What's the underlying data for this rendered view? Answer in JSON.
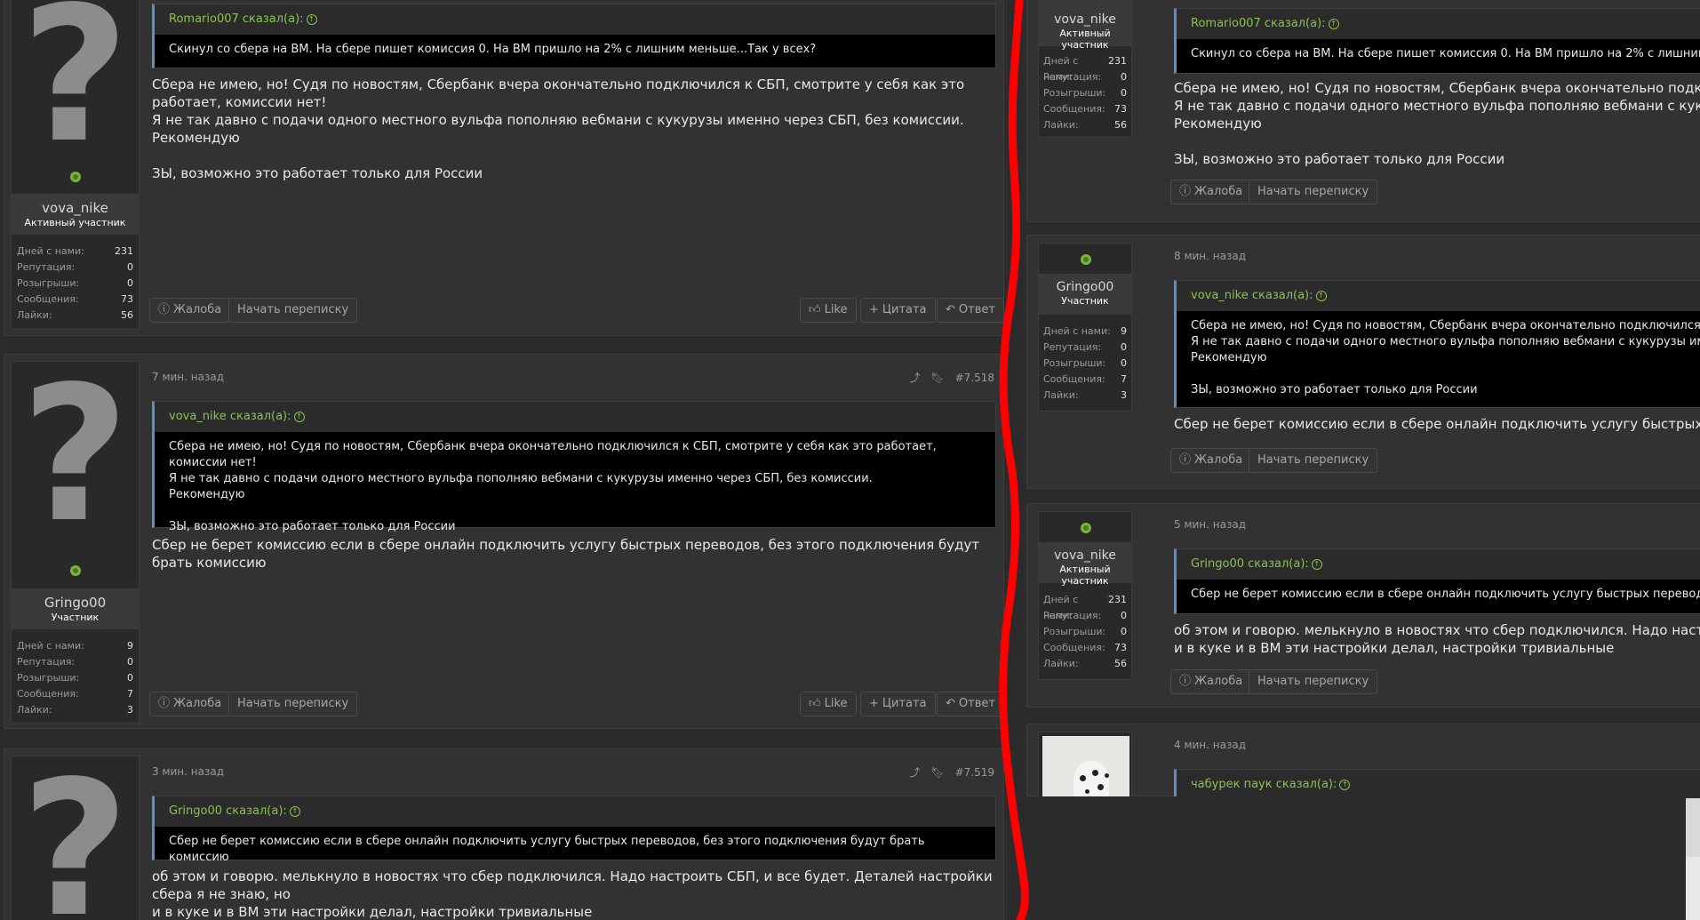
{
  "actions": {
    "report": "Жалоба",
    "start_conversation": "Начать переписку",
    "like": "Like",
    "quote": "Цитата",
    "reply": "Ответ"
  },
  "stat_labels": {
    "days": "Дней с нами:",
    "reputation": "Репутация:",
    "giveaways": "Розыгрыши:",
    "messages": "Сообщения:",
    "likes": "Лайки:"
  },
  "users": {
    "vova": {
      "name": "vova_nike",
      "title": "Активный участник",
      "days": "231",
      "reputation": "0",
      "giveaways": "0",
      "messages": "73",
      "likes": "56"
    },
    "gringo": {
      "name": "Gringo00",
      "title": "Участник",
      "days": "9",
      "reputation": "0",
      "giveaways": "0",
      "messages": "7",
      "likes": "3"
    }
  },
  "left": {
    "post1": {
      "quote_author": "Romario007 сказал(а):",
      "quote_text": "Скинул со сбера на ВМ. На сбере пишет комиссия 0. На ВМ пришло на 2% с лишним меньше...Так у всех?",
      "text": "Сбера не имею, но! Судя по новостям, Сбербанк вчера окончательно подключился к СБП, смотрите у себя как это работает, комиссии нет!\nЯ не так давно с подачи одного местного вульфа пополняю вебмани с кукурузы именно через СБП, без комиссии.\nРекомендую\n\nЗЫ, возможно это работает только для России"
    },
    "post2": {
      "time": "7 мин. назад",
      "number": "#7.518",
      "quote_author": "vova_nike сказал(а):",
      "quote_text": "Сбера не имею, но! Судя по новостям, Сбербанк вчера окончательно подключился к СБП, смотрите у себя как это работает, комиссии нет!\nЯ не так давно с подачи одного местного вульфа пополняю вебмани с кукурузы именно через СБП, без комиссии.\nРекомендую\n\nЗЫ, возможно это работает только для России",
      "text": "Сбер не берет комиссию если в сбере онлайн подключить услугу быстрых переводов, без этого подключения будут брать комиссию"
    },
    "post3": {
      "time": "3 мин. назад",
      "number": "#7.519",
      "quote_author": "Gringo00 сказал(а):",
      "quote_text": "Сбер не берет комиссию если в сбере онлайн подключить услугу быстрых переводов, без этого подключения будут брать комиссию",
      "text": "об этом и говорю. мелькнуло в новостях что сбер подключился. Надо настроить СБП, и все будет. Деталей настройки сбера я не знаю, но\nи в куке и в ВМ эти настройки делал, настройки тривиальные"
    }
  },
  "right": {
    "post1": {
      "quote_author": "Romario007 сказал(а):",
      "quote_text": "Скинул со сбера на ВМ. На сбере пишет комиссия 0. На ВМ пришло на 2% с лишним меньше...Так у всех?",
      "text": "Сбера не имею, но! Судя по новостям, Сбербанк вчера окончательно подключился к СБП, смотрите у себя как это работает, комиссии нет!\nЯ не так давно с подачи одного местного вульфа пополняю вебмани с кукурузы именно через СБП, без комиссии.\nРекомендую\n\nЗЫ, возможно это работает только для России"
    },
    "post2": {
      "time": "8 мин. назад",
      "quote_author": "vova_nike сказал(а):",
      "quote_text": "Сбера не имею, но! Судя по новостям, Сбербанк вчера окончательно подключился к СБП, смотрите у себя как это работает, комиссии нет!\nЯ не так давно с подачи одного местного вульфа пополняю вебмани с кукурузы именно через СБП, без комиссии.\nРекомендую\n\nЗЫ, возможно это работает только для России",
      "text": "Сбер не берет комиссию если в сбере онлайн подключить услугу быстрых переводов, без этого подключения будут брать комиссию"
    },
    "post3": {
      "time": "5 мин. назад",
      "quote_author": "Gringo00 сказал(а):",
      "quote_text": "Сбер не берет комиссию если в сбере онлайн подключить услугу быстрых переводов, без этого подключения будут брать комиссию",
      "text": "об этом и говорю. мелькнуло в новостях что сбер подключился. Надо настроить СБП, и все будет. Деталей настройки сбера я не знаю, но\nи в куке и в ВМ эти настройки делал, настройки тривиальные"
    },
    "post4": {
      "time": "4 мин. назад",
      "quote_author": "чабурек паук сказал(а):"
    }
  },
  "colors": {
    "accent_green": "#8bc34a",
    "quote_border": "#5d8fc0",
    "annotation_red": "#ff0000"
  },
  "icons": {
    "avatar": "question-mark-icon",
    "online": "online-status-icon",
    "report": "info-circle-icon",
    "like": "thumbs-up-icon",
    "quote": "plus-icon",
    "reply": "reply-arrow-icon",
    "share": "share-icon",
    "bookmark": "bookmark-icon"
  }
}
